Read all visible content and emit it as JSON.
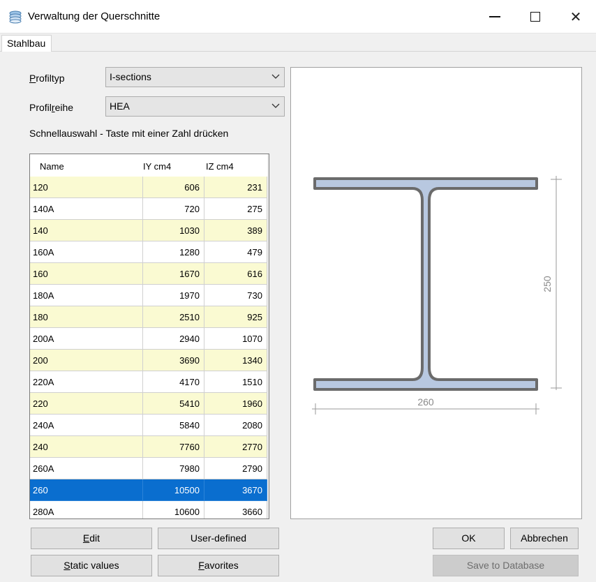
{
  "window": {
    "title": "Verwaltung der Querschnitte",
    "min_glyph": "—",
    "close_glyph": "✕"
  },
  "tabs": [
    {
      "label": "Stahlbau",
      "active": true
    }
  ],
  "form": {
    "profiltyp_label_u": "P",
    "profiltyp_label_rest": "rofiltyp",
    "profiltyp_value": "I-sections",
    "profilreihe_label_pre": "Profil",
    "profilreihe_label_u": "r",
    "profilreihe_label_post": "eihe",
    "profilreihe_value": "HEA",
    "hint": "Schnellauswahl - Taste mit einer Zahl drücken"
  },
  "table": {
    "columns": [
      "Name",
      "IY cm4",
      "IZ cm4"
    ],
    "rows": [
      {
        "name": "120",
        "iy": "606",
        "iz": "231"
      },
      {
        "name": "140A",
        "iy": "720",
        "iz": "275"
      },
      {
        "name": "140",
        "iy": "1030",
        "iz": "389"
      },
      {
        "name": "160A",
        "iy": "1280",
        "iz": "479"
      },
      {
        "name": "160",
        "iy": "1670",
        "iz": "616"
      },
      {
        "name": "180A",
        "iy": "1970",
        "iz": "730"
      },
      {
        "name": "180",
        "iy": "2510",
        "iz": "925"
      },
      {
        "name": "200A",
        "iy": "2940",
        "iz": "1070"
      },
      {
        "name": "200",
        "iy": "3690",
        "iz": "1340"
      },
      {
        "name": "220A",
        "iy": "4170",
        "iz": "1510"
      },
      {
        "name": "220",
        "iy": "5410",
        "iz": "1960"
      },
      {
        "name": "240A",
        "iy": "5840",
        "iz": "2080"
      },
      {
        "name": "240",
        "iy": "7760",
        "iz": "2770"
      },
      {
        "name": "260A",
        "iy": "7980",
        "iz": "2790"
      },
      {
        "name": "260",
        "iy": "10500",
        "iz": "3670"
      },
      {
        "name": "280A",
        "iy": "10600",
        "iz": "3660"
      }
    ],
    "selected_name": "260"
  },
  "preview": {
    "width_dim": "260",
    "height_dim": "250"
  },
  "buttons": {
    "edit_u": "E",
    "edit_rest": "dit",
    "user_defined": "User-defined",
    "static_u": "S",
    "static_rest": "tatic values",
    "favorites_u": "F",
    "favorites_rest": "avorites",
    "ok": "OK",
    "cancel": "Abbrechen",
    "save_db": "Save  to Database"
  },
  "colors": {
    "selection": "#0a6ecf",
    "row_alt": "#fafad2",
    "section_fill": "#b8c8e0",
    "section_stroke": "#6b6b6b"
  }
}
